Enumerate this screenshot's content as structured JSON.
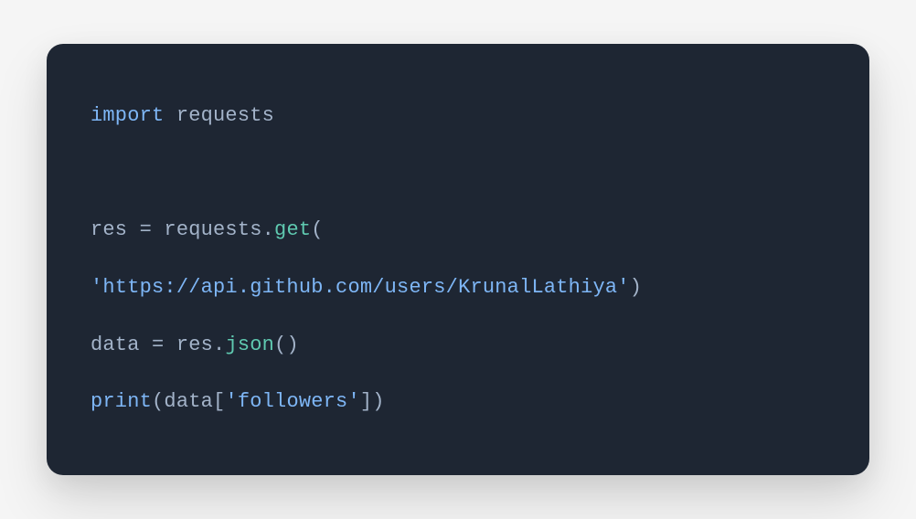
{
  "code": {
    "line1": {
      "t1": "import",
      "t2": " requests"
    },
    "line2": " ",
    "line3": {
      "t1": "res ",
      "t2": "=",
      "t3": " requests",
      "t4": ".",
      "t5": "get",
      "t6": "("
    },
    "line4": {
      "t1": "'https://api.github.com/users/KrunalLathiya'",
      "t2": ")"
    },
    "line5": {
      "t1": "data ",
      "t2": "=",
      "t3": " res",
      "t4": ".",
      "t5": "json",
      "t6": "()"
    },
    "line6": {
      "t1": "print",
      "t2": "(data[",
      "t3": "'followers'",
      "t4": "])"
    }
  }
}
